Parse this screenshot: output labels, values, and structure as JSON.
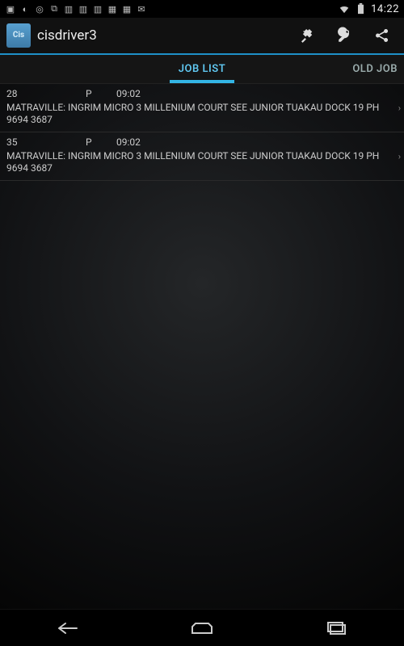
{
  "status": {
    "clock": "14:22"
  },
  "app": {
    "icon_text": "Cis",
    "title": "cisdriver3"
  },
  "tabs": {
    "active": "JOB LIST",
    "right": "OLD JOB"
  },
  "jobs": [
    {
      "id": "28",
      "flag": "P",
      "time": "09:02",
      "desc": "MATRAVILLE: INGRIM MICRO 3 MILLENIUM  COURT SEE JUNIOR TUAKAU DOCK 19 PH 9694 3687"
    },
    {
      "id": "35",
      "flag": "P",
      "time": "09:02",
      "desc": "MATRAVILLE: INGRIM MICRO 3 MILLENIUM  COURT SEE JUNIOR TUAKAU DOCK 19 PH 9694 3687"
    }
  ]
}
